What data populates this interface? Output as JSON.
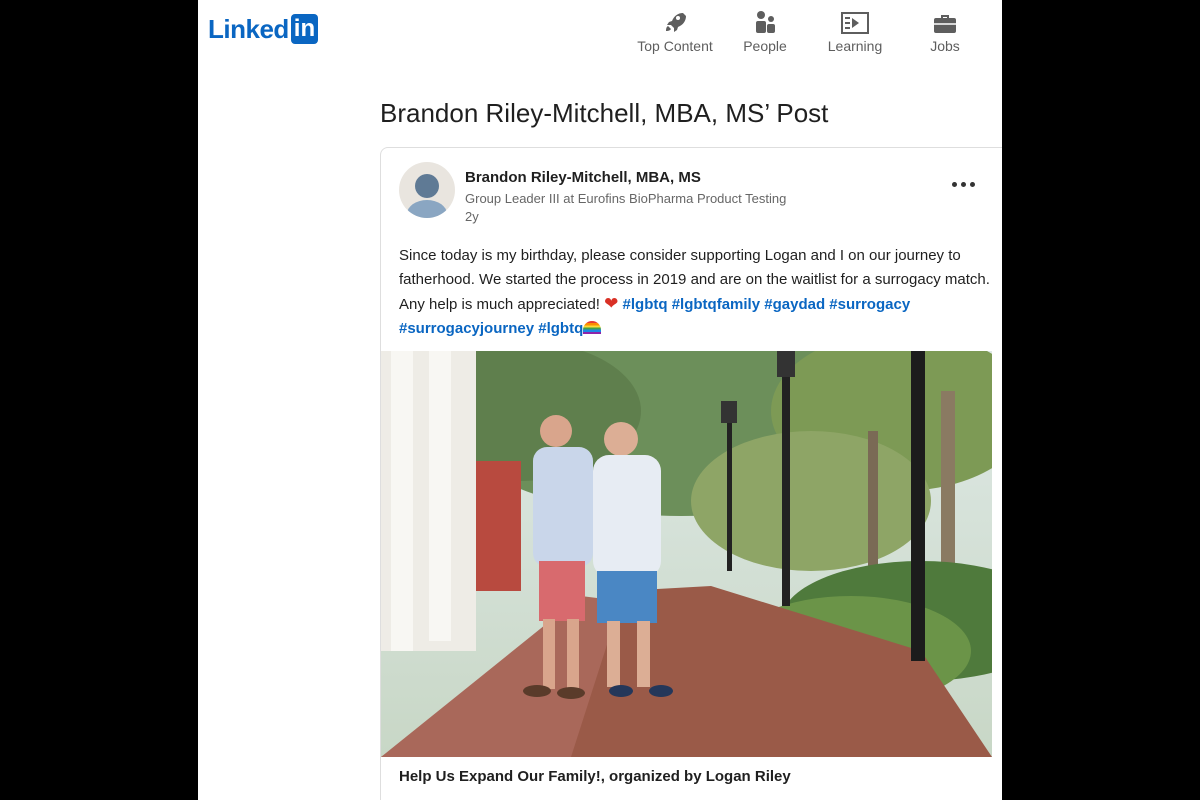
{
  "header": {
    "logo_text": "Linked",
    "logo_box_text": "in",
    "nav": [
      {
        "label": "Top Content",
        "icon": "rocket-icon"
      },
      {
        "label": "People",
        "icon": "people-icon"
      },
      {
        "label": "Learning",
        "icon": "learning-icon"
      },
      {
        "label": "Jobs",
        "icon": "briefcase-icon"
      }
    ]
  },
  "page_title": "Brandon Riley-Mitchell, MBA, MS’ Post",
  "post": {
    "author_name": "Brandon Riley-Mitchell, MBA, MS",
    "author_title": "Group Leader III at Eurofins BioPharma Product Testing",
    "age": "2y",
    "text": "Since today is my birthday, please consider supporting Logan and I on our journey to fatherhood. We started the process in 2019 and are on the waitlist for a surrogacy match. Any help is much appreciated!",
    "heart": "❤",
    "hashtags": [
      "#lgbtq",
      "#lgbtqfamily",
      "#gaydad",
      "#surrogacy",
      "#surrogacyjourney",
      "#lgbtq"
    ],
    "link_caption": "Help Us Expand Our Family!, organized by Logan Riley"
  },
  "colors": {
    "brand": "#0a66c2",
    "text": "#1f1f1f",
    "muted": "#666666"
  }
}
